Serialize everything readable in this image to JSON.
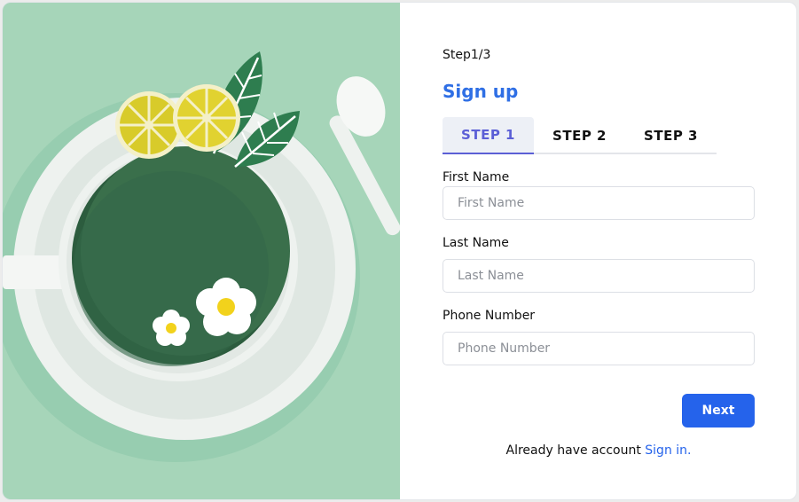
{
  "colors": {
    "accent": "#2563eb",
    "tab_active": "#5b5fd6",
    "hero_background": "#a6d5b9"
  },
  "hero": {
    "image": "tea-cup-illustration"
  },
  "form": {
    "step_count": "Step1/3",
    "title": "Sign up",
    "tabs": [
      {
        "label": "STEP 1",
        "active": true
      },
      {
        "label": "STEP 2",
        "active": false
      },
      {
        "label": "STEP 3",
        "active": false
      }
    ],
    "fields": {
      "first_name": {
        "label": "First Name",
        "placeholder": "First Name",
        "value": ""
      },
      "last_name": {
        "label": "Last Name",
        "placeholder": "Last Name",
        "value": ""
      },
      "phone_number": {
        "label": "Phone Number",
        "placeholder": "Phone Number",
        "value": ""
      }
    },
    "next_label": "Next",
    "signin_prompt": "Already have account",
    "signin_link": "Sign in."
  }
}
